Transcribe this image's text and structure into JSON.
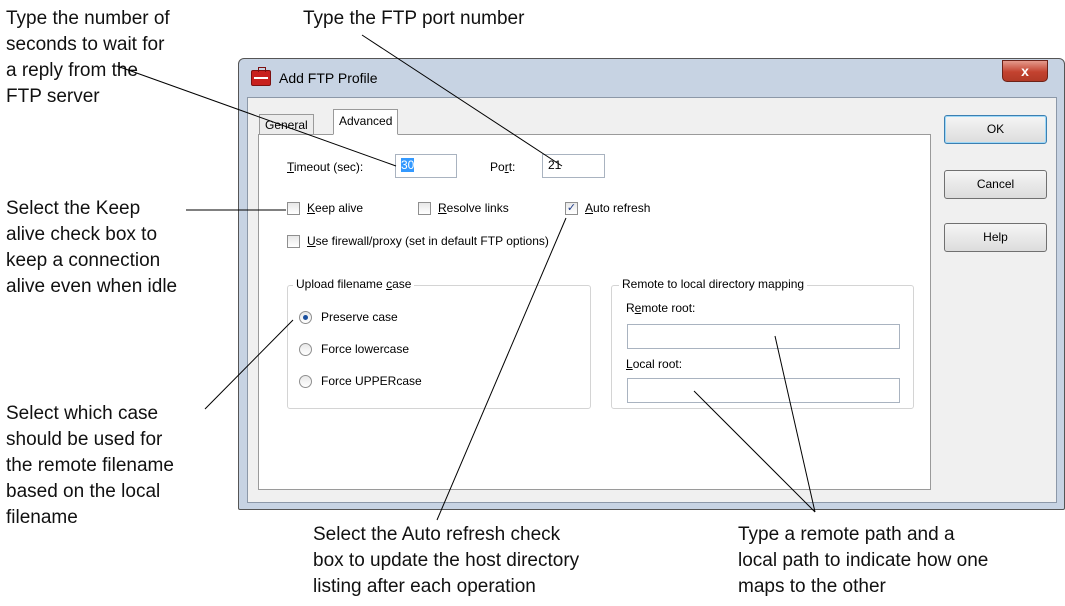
{
  "dialog": {
    "title": "Add FTP Profile",
    "close_glyph": "x",
    "tabs": [
      {
        "label": "General",
        "active": false
      },
      {
        "label": "Advanced",
        "active": true
      }
    ],
    "timeout": {
      "label_first": "T",
      "label_rest": "imeout (sec):",
      "value": "30"
    },
    "port": {
      "label_pre": "Po",
      "label_u": "r",
      "label_post": "t:",
      "value": "21"
    },
    "checkboxes": {
      "keep_alive": {
        "u": "K",
        "rest": "eep alive",
        "checked": false
      },
      "resolve_links": {
        "u": "R",
        "rest": "esolve links",
        "checked": false
      },
      "auto_refresh": {
        "u": "A",
        "rest": "uto refresh",
        "checked": true
      },
      "firewall": {
        "u": "U",
        "rest": "se firewall/proxy (set in default FTP options)",
        "checked": false
      }
    },
    "upload_case": {
      "legend_pre": "Upload filename ",
      "legend_u": "c",
      "legend_post": "ase",
      "options": [
        {
          "label": "Preserve case",
          "selected": true
        },
        {
          "label": "Force lowercase",
          "selected": false
        },
        {
          "label": "Force UPPERcase",
          "selected": false
        }
      ]
    },
    "mapping": {
      "legend": "Remote to local directory mapping",
      "remote_root": {
        "pre": "R",
        "u": "e",
        "post": "mote root:",
        "value": ""
      },
      "local_root": {
        "u": "L",
        "post": "ocal root:",
        "value": ""
      }
    },
    "buttons": {
      "ok": "OK",
      "cancel": "Cancel",
      "help": "Help"
    },
    "check_glyph": "✓"
  },
  "callouts": {
    "timeout": [
      "Type the number of",
      "seconds to wait for",
      "a reply from the",
      "FTP server"
    ],
    "port": [
      "Type the FTP port number"
    ],
    "keep_alive": [
      "Select the Keep",
      "alive check box to",
      "keep a connection",
      "alive even when idle"
    ],
    "case": [
      "Select which case",
      "should be used for",
      "the remote filename",
      "based on the local",
      "filename"
    ],
    "auto_refresh": [
      "Select the Auto refresh check",
      "box to update the host directory",
      "listing after each operation"
    ],
    "mapping": [
      "Type a remote path and a",
      "local path to indicate how one",
      "maps to the other"
    ]
  }
}
